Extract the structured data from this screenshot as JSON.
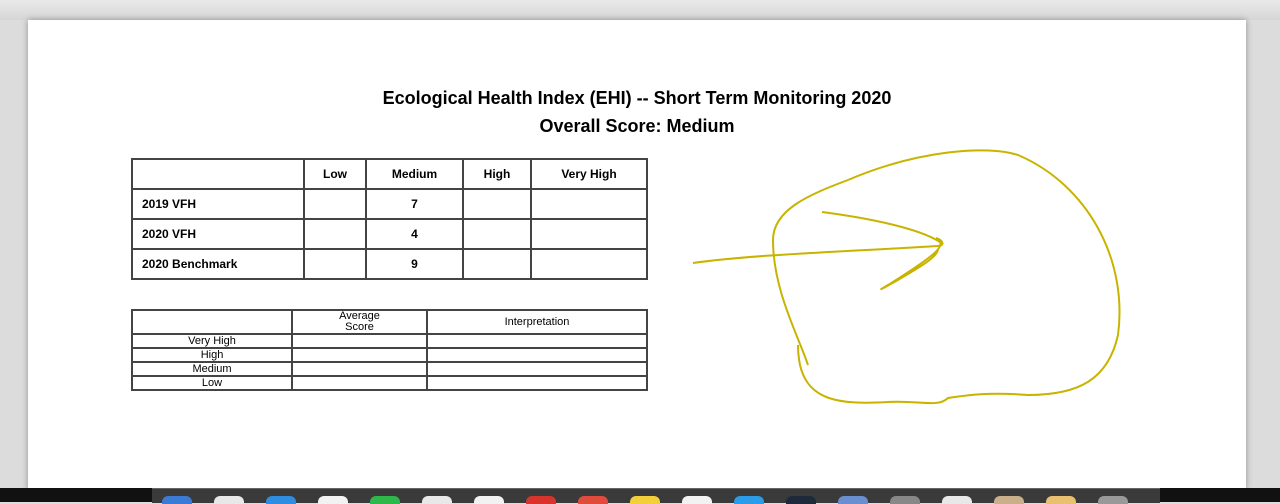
{
  "document": {
    "title": "Ecological Health Index (EHI) -- Short Term Monitoring 2020",
    "subtitle": "Overall Score: Medium"
  },
  "score_table": {
    "columns": [
      "",
      "Low",
      "Medium",
      "High",
      "Very High"
    ],
    "rows": [
      {
        "label": "2019 VFH",
        "low": "",
        "medium": "7",
        "high": "",
        "very_high": ""
      },
      {
        "label": "2020 VFH",
        "low": "",
        "medium": "4",
        "high": "",
        "very_high": ""
      },
      {
        "label": "2020 Benchmark",
        "low": "",
        "medium": "9",
        "high": "",
        "very_high": ""
      }
    ]
  },
  "interpretation_table": {
    "columns": [
      "",
      "Average Score",
      "Interpretation"
    ],
    "rows": [
      {
        "label": "Very High",
        "average": "",
        "interpretation": ""
      },
      {
        "label": "High",
        "average": "",
        "interpretation": ""
      },
      {
        "label": "Medium",
        "average": "",
        "interpretation": ""
      },
      {
        "label": "Low",
        "average": "",
        "interpretation": ""
      }
    ]
  },
  "annotation": {
    "color": "#c8b400",
    "shape": "hand-drawn arrow inside loop"
  },
  "dock": {
    "icon_colors": [
      "#3b7bd6",
      "#e8e8e8",
      "#2e8de0",
      "#f2f2f2",
      "#2fb84a",
      "#e8e8e8",
      "#f2f2f2",
      "#d9342b",
      "#e14b3c",
      "#f3cf3a",
      "#f2f2f2",
      "#2a9ce8",
      "#1e2a3c",
      "#6a8fd0",
      "#888888",
      "#e8e8e8",
      "#c9b08a",
      "#e8c070",
      "#999999"
    ]
  }
}
